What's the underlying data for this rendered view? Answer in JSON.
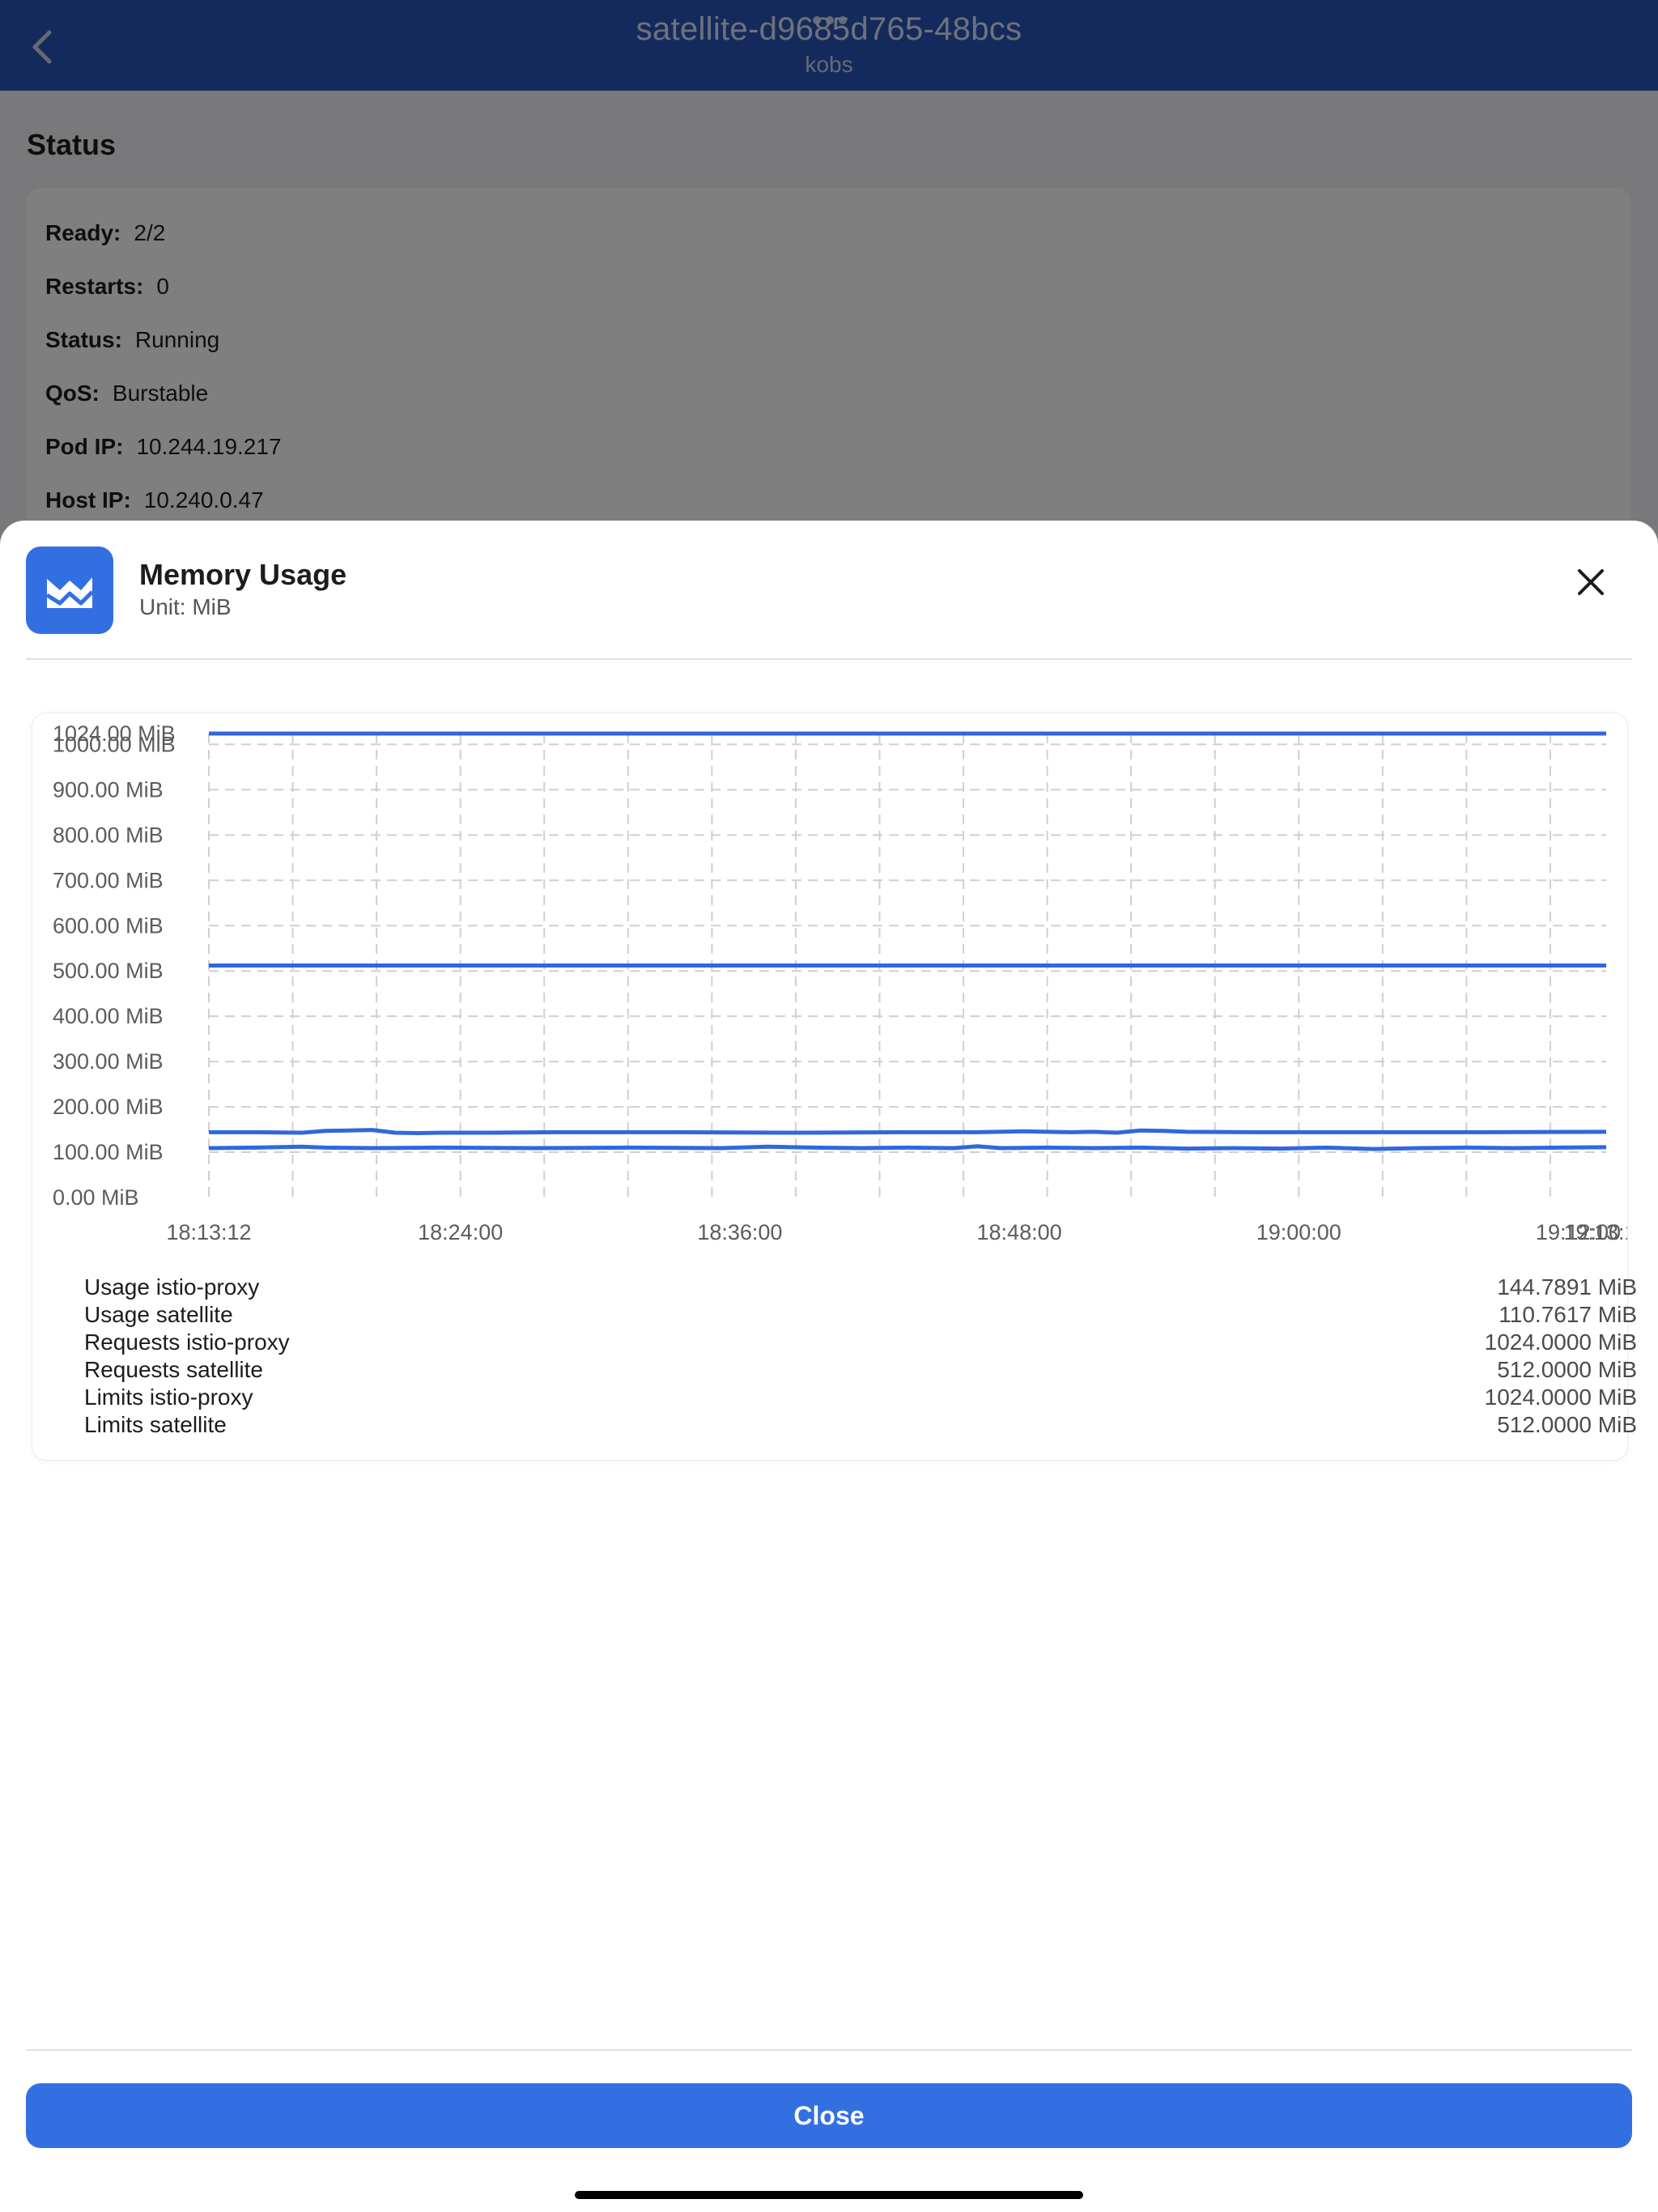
{
  "header": {
    "title": "satellite-d9685d765-48bcs",
    "subtitle": "kobs"
  },
  "status": {
    "section_title": "Status",
    "rows": [
      {
        "label": "Ready:",
        "value": "2/2"
      },
      {
        "label": "Restarts:",
        "value": "0"
      },
      {
        "label": "Status:",
        "value": "Running"
      },
      {
        "label": "QoS:",
        "value": "Burstable"
      },
      {
        "label": "Pod IP:",
        "value": "10.244.19.217"
      },
      {
        "label": "Host IP:",
        "value": "10.240.0.47"
      }
    ]
  },
  "modal": {
    "icon": "area-chart-icon",
    "title": "Memory Usage",
    "unit_label": "Unit: MiB",
    "close_button": "Close"
  },
  "colors": {
    "accent": "#3270e2",
    "header": "#2b55b8",
    "series_line": "#3068dc"
  },
  "chart_data": {
    "type": "line",
    "unit": "MiB",
    "ylim": [
      0,
      1024
    ],
    "y_ticks": [
      "0.00 MiB",
      "100.00 MiB",
      "200.00 MiB",
      "300.00 MiB",
      "400.00 MiB",
      "500.00 MiB",
      "600.00 MiB",
      "700.00 MiB",
      "800.00 MiB",
      "900.00 MiB",
      "1000.00 MiB",
      "1024.00 MiB"
    ],
    "y_tick_values": [
      0,
      100,
      200,
      300,
      400,
      500,
      600,
      700,
      800,
      900,
      1000,
      1024
    ],
    "x_ticks": [
      "18:13:12",
      "18:24:00",
      "18:36:00",
      "18:48:00",
      "19:00:00",
      "19:12:00",
      "19:13:12"
    ],
    "x_tick_minutes": [
      0,
      10.8,
      22.8,
      34.8,
      46.8,
      58.8,
      60
    ],
    "x_range_minutes": [
      0,
      60
    ],
    "grid": true,
    "legend_position": "bottom",
    "series": [
      {
        "name": "Usage istio-proxy",
        "value_label": "144.7891 MiB",
        "x": [
          0,
          2,
          4,
          5,
          6,
          7,
          8,
          9,
          10,
          12,
          15,
          20,
          25,
          30,
          33,
          35,
          36,
          37,
          38,
          39,
          40,
          41,
          42,
          45,
          50,
          55,
          60
        ],
        "y": [
          144,
          144,
          143,
          147,
          148,
          149,
          143,
          142,
          143,
          143,
          144,
          144,
          143,
          144,
          144,
          146,
          145,
          144,
          145,
          143,
          148,
          147,
          145,
          144,
          144,
          144,
          145
        ]
      },
      {
        "name": "Usage satellite",
        "value_label": "110.7617 MiB",
        "x": [
          0,
          2,
          4,
          5,
          7,
          10,
          14,
          18,
          22,
          24,
          26,
          28,
          30,
          32,
          33,
          34,
          36,
          38,
          40,
          42,
          44,
          46,
          48,
          50,
          52,
          54,
          56,
          58,
          60
        ],
        "y": [
          109,
          110,
          112,
          110,
          109,
          110,
          109,
          110,
          109,
          112,
          110,
          109,
          110,
          109,
          113,
          109,
          110,
          109,
          110,
          108,
          109,
          108,
          110,
          107,
          109,
          110,
          109,
          110,
          111
        ]
      },
      {
        "name": "Requests istio-proxy",
        "value_label": "1024.0000 MiB",
        "x": [
          0,
          60
        ],
        "y": [
          1024,
          1024
        ]
      },
      {
        "name": "Requests satellite",
        "value_label": "512.0000 MiB",
        "x": [
          0,
          60
        ],
        "y": [
          512,
          512
        ]
      },
      {
        "name": "Limits istio-proxy",
        "value_label": "1024.0000 MiB",
        "x": [
          0,
          60
        ],
        "y": [
          1024,
          1024
        ]
      },
      {
        "name": "Limits satellite",
        "value_label": "512.0000 MiB",
        "x": [
          0,
          60
        ],
        "y": [
          512,
          512
        ]
      }
    ]
  }
}
